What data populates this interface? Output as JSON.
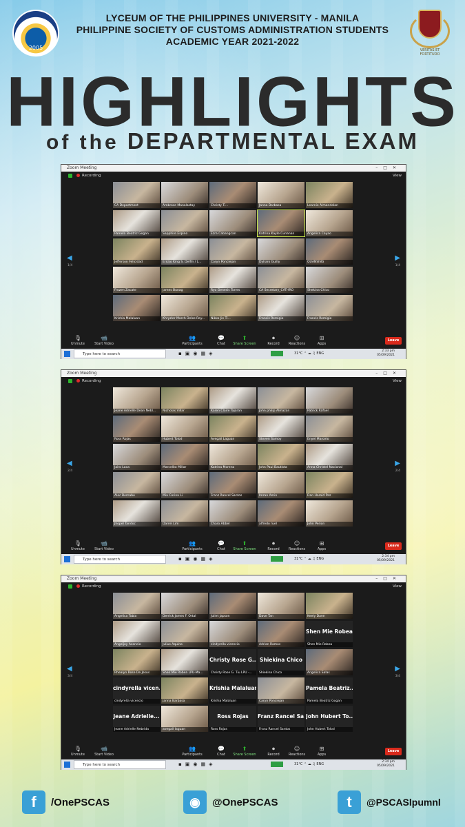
{
  "header": {
    "line1": "LYCEUM OF THE PHILIPPINES UNIVERSITY - MANILA",
    "line2": "PHILIPPINE SOCIETY OF CUSTOMS ADMINISTRATION STUDENTS",
    "line3": "ACADEMIC YEAR 2021-2022",
    "left_logo_year": "2005"
  },
  "title": "HIGHLIGHTS",
  "subtitle_of": "of the",
  "subtitle": "DEPARTMENTAL EXAM",
  "zoom": {
    "window_title": "Zoom Meeting",
    "recording": "Recording",
    "view": "View",
    "controls": [
      "Unmute",
      "Start Video",
      "Participants",
      "Chat",
      "Share Screen",
      "Record",
      "Reactions",
      "Apps"
    ],
    "participant_count": "93",
    "leave": "Leave",
    "search_placeholder": "Type here to search",
    "weather": "31°C",
    "lang": "ENG"
  },
  "screens": [
    {
      "page_left": "1/4",
      "page_right": "1/4",
      "time": "2:33 pm",
      "date": "05/09/2021",
      "tiles": [
        {
          "name": "CA Department",
          "type": "photo"
        },
        {
          "name": "Ambrose Manalastay",
          "type": "photo"
        },
        {
          "name": "Christy Ti...",
          "type": "photo"
        },
        {
          "name": "Janna Barbasa",
          "type": "photo"
        },
        {
          "name": "Learnie Almandolan",
          "type": "photo"
        },
        {
          "name": "Pamela Beatriz Gogan",
          "type": "photo"
        },
        {
          "name": "Sapphire Espino",
          "type": "photo"
        },
        {
          "name": "Ezra Cabangcan",
          "type": "photo"
        },
        {
          "name": "Katrina Kayle Cunanan",
          "type": "photo",
          "selected": true
        },
        {
          "name": "Angelica Cayao",
          "type": "photo"
        },
        {
          "name": "Jefferson Felicidad",
          "type": "photo"
        },
        {
          "name": "Ericko King S. Delfin / L...",
          "type": "photo"
        },
        {
          "name": "Caryn Ponciejan",
          "type": "photo"
        },
        {
          "name": "Dyharo Guilly",
          "type": "photo"
        },
        {
          "name": "QUANSING",
          "type": "photo"
        },
        {
          "name": "Frozen Zacate",
          "type": "photo"
        },
        {
          "name": "James Bunag",
          "type": "photo"
        },
        {
          "name": "Ryo Genesis Torres",
          "type": "photo"
        },
        {
          "name": "CA Secretary_CATHRO",
          "type": "photo"
        },
        {
          "name": "Shekina Chico",
          "type": "photo"
        },
        {
          "name": "Krishia Malaluan",
          "type": "photo"
        },
        {
          "name": "Khryzler March Delos Rey...",
          "type": "photo"
        },
        {
          "name": "Nikko Jie Ti...",
          "type": "photo"
        },
        {
          "name": "Francis Remigio",
          "type": "photo"
        },
        {
          "name": "Francis Remigio",
          "type": "photo"
        }
      ]
    },
    {
      "page_left": "2/4",
      "page_right": "2/4",
      "time": "2:34 pm",
      "date": "05/09/2021",
      "tiles": [
        {
          "name": "Jeane Adrielle Dean Nebl...",
          "type": "photo"
        },
        {
          "name": "Nicholas Villar",
          "type": "photo"
        },
        {
          "name": "Karen Claire Tajaran",
          "type": "photo"
        },
        {
          "name": "John philip Almazan",
          "type": "photo"
        },
        {
          "name": "Patrick Rafael",
          "type": "photo"
        },
        {
          "name": "Ross Rojas",
          "type": "photo"
        },
        {
          "name": "Hubert Tolod",
          "type": "photo"
        },
        {
          "name": "Avegail Laguan",
          "type": "photo"
        },
        {
          "name": "Steven Samoy",
          "type": "photo"
        },
        {
          "name": "Enyel Marcelo",
          "type": "photo"
        },
        {
          "name": "Jairo Laxa",
          "type": "photo"
        },
        {
          "name": "Marcelito Millar",
          "type": "photo"
        },
        {
          "name": "Katrina Moreno",
          "type": "photo"
        },
        {
          "name": "John Paul Bautista",
          "type": "photo"
        },
        {
          "name": "Anna Christel Nacional",
          "type": "photo"
        },
        {
          "name": "Alec Bernabe",
          "type": "photo"
        },
        {
          "name": "Mia Corina Li",
          "type": "photo"
        },
        {
          "name": "Franz Rancel Santos",
          "type": "photo"
        },
        {
          "name": "Imran Amin",
          "type": "photo"
        },
        {
          "name": "Dan Harold Paz",
          "type": "photo"
        },
        {
          "name": "Jhopel Tandoc",
          "type": "photo"
        },
        {
          "name": "Darrel Lim",
          "type": "photo"
        },
        {
          "name": "Charo Abbel",
          "type": "photo"
        },
        {
          "name": "alfredo ruel",
          "type": "photo"
        },
        {
          "name": "John Perion",
          "type": "photo"
        }
      ]
    },
    {
      "page_left": "3/4",
      "page_right": "3/4",
      "time": "2:34 pm",
      "date": "05/09/2021",
      "tiles": [
        {
          "name": "Angelica Tobia",
          "type": "photo"
        },
        {
          "name": "Derrick James F. Ortal",
          "type": "photo"
        },
        {
          "name": "Juliet Japson",
          "type": "photo"
        },
        {
          "name": "Dave Tan",
          "type": "photo"
        },
        {
          "name": "Keely Dave",
          "type": "photo"
        },
        {
          "name": "Angeljoy Aconcio",
          "type": "photo"
        },
        {
          "name": "Julius Aquino",
          "type": "photo"
        },
        {
          "name": "cindyrella vicencio",
          "type": "photo"
        },
        {
          "name": "Adrian Ramos",
          "type": "photo"
        },
        {
          "name": "Shen Mie Robea",
          "big": "Shen Mie Robea",
          "type": "text"
        },
        {
          "name": "Rhealyn Rose De Jesus",
          "type": "photo"
        },
        {
          "name": "Shen Mie Robea LPU-Ma...",
          "type": "photo"
        },
        {
          "name": "Christy Rose G. Tiu LPU -...",
          "big": "Christy Rose G...",
          "type": "text"
        },
        {
          "name": "Shiekina Chico",
          "big": "Shiekina Chico",
          "type": "text"
        },
        {
          "name": "Angelica Salas",
          "type": "photo"
        },
        {
          "name": "cindyrella vicencio",
          "big": "cindyrella vicen...",
          "type": "text"
        },
        {
          "name": "Janna Barbasa",
          "type": "photo"
        },
        {
          "name": "Krishia Malaluan",
          "big": "Krishia Malaluan",
          "type": "text"
        },
        {
          "name": "Caryn Ponciejan",
          "type": "photo"
        },
        {
          "name": "Pamela Beatriz Gogan",
          "big": "Pamela Beatriz...",
          "type": "text"
        },
        {
          "name": "Jeane Adrielle Nebrida",
          "big": "Jeane Adrielle...",
          "type": "text"
        },
        {
          "name": "avegail laguan",
          "type": "photo"
        },
        {
          "name": "Ross Rojas",
          "big": "Ross Rojas",
          "type": "text"
        },
        {
          "name": "Franz Rancel Santos",
          "big": "Franz Rancel Sa...",
          "type": "text"
        },
        {
          "name": "John Hubert Tolod",
          "big": "John Hubert To...",
          "type": "text"
        }
      ]
    }
  ],
  "footer": {
    "facebook": "/OnePSCAS",
    "instagram": "@OnePSCAS",
    "twitter": "@PSCASlpumnl"
  }
}
